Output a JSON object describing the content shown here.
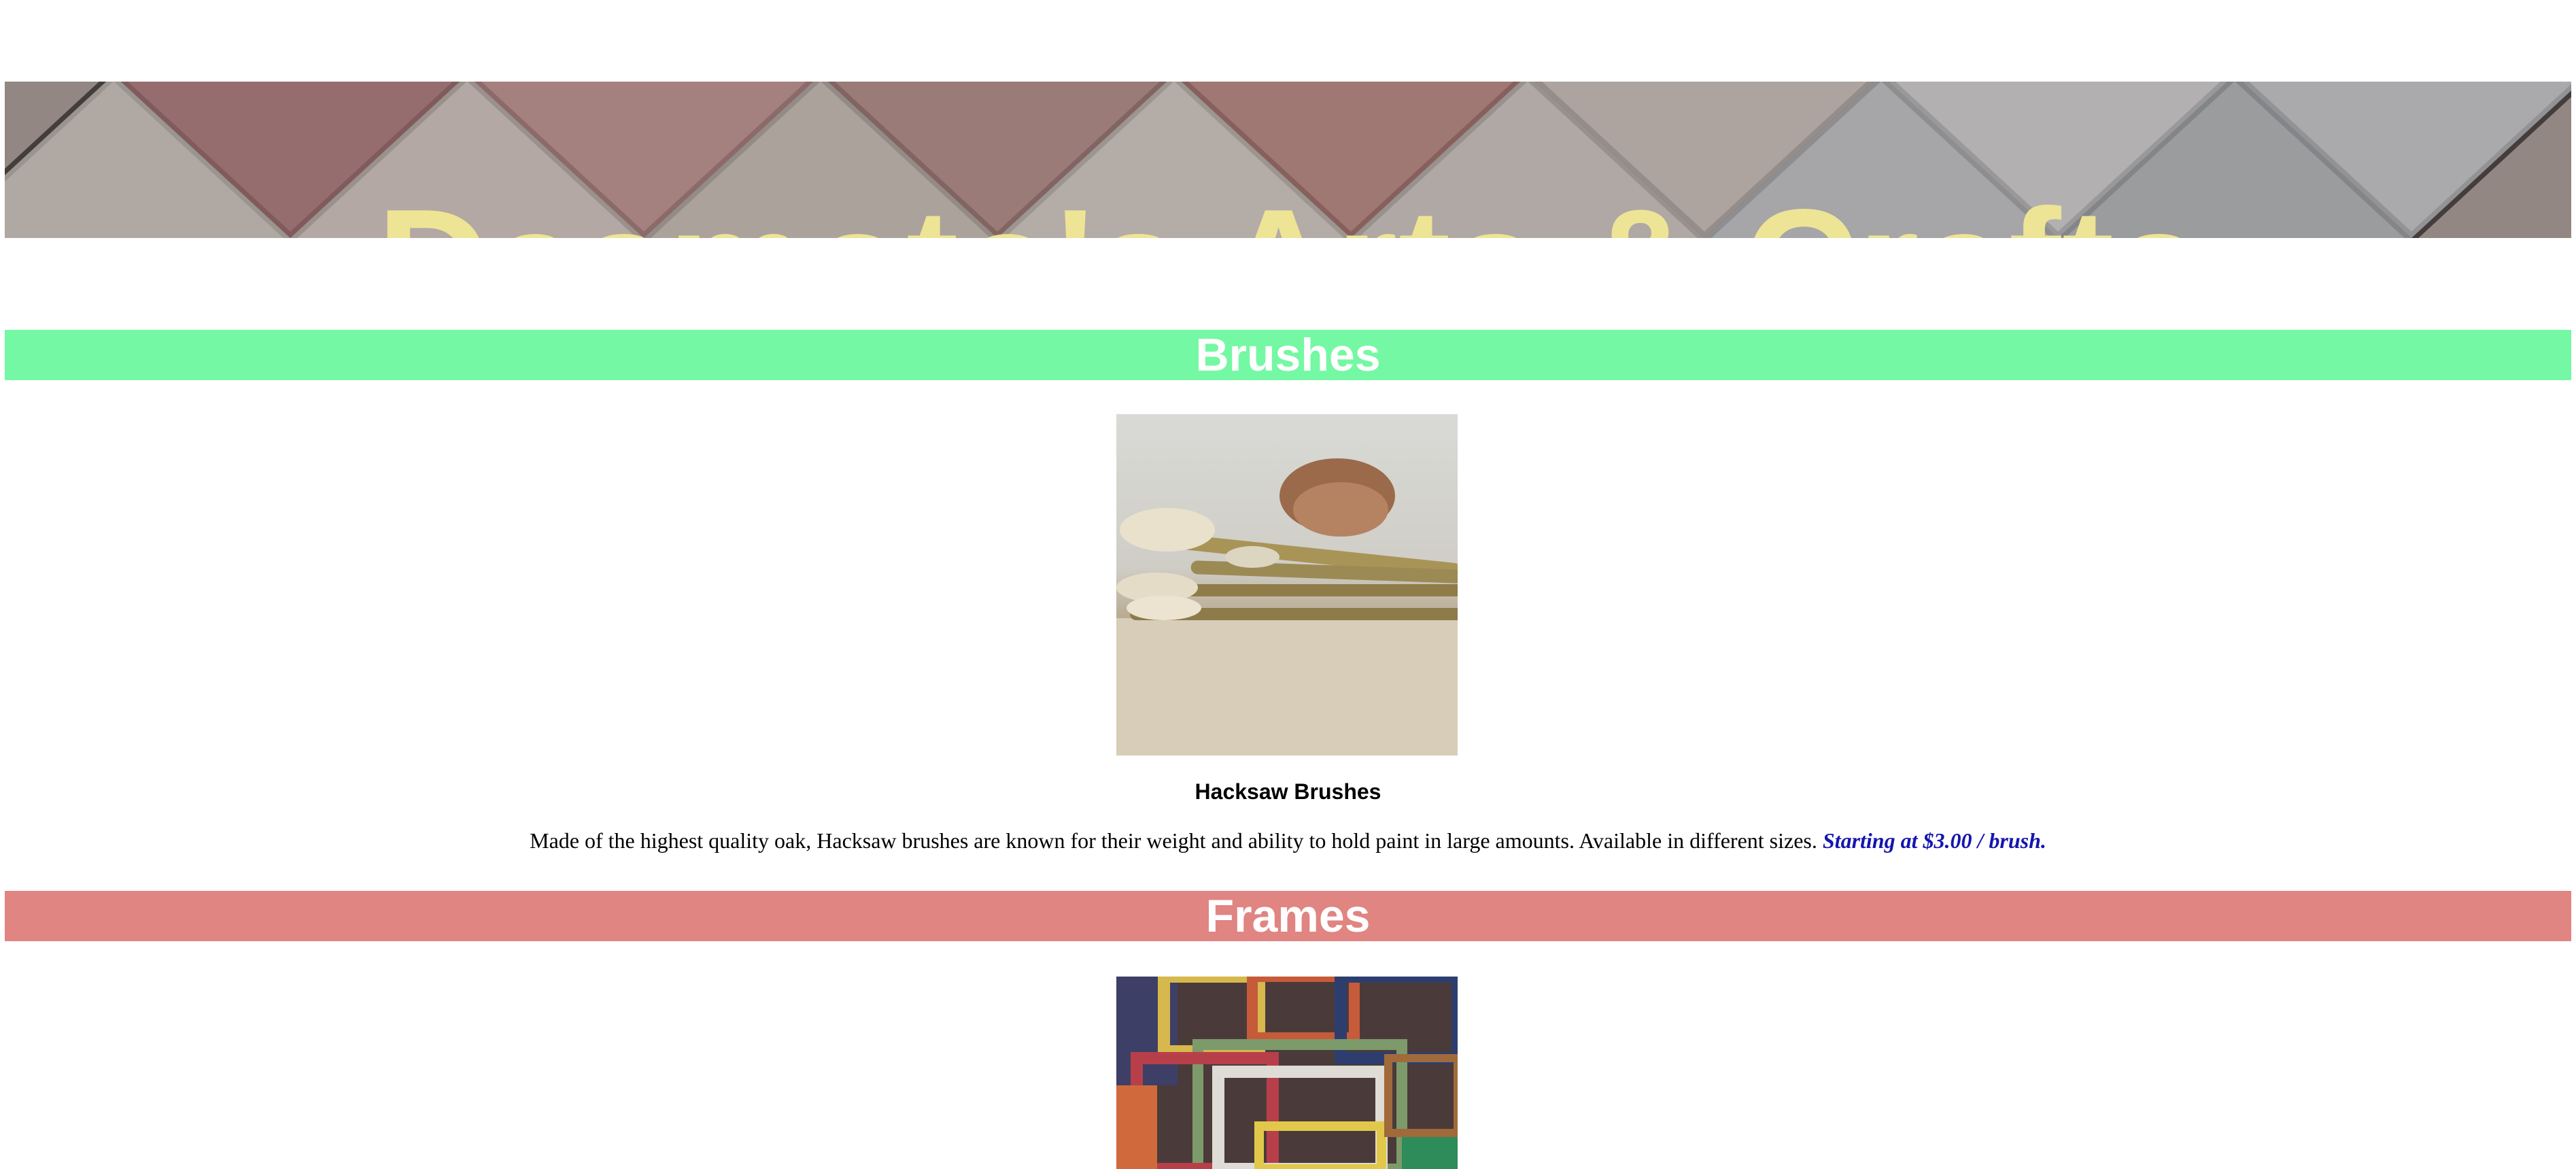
{
  "banner": {
    "title": "Dasmoto's Arts & Crafts"
  },
  "sections": [
    {
      "header": "Brushes",
      "color": "#75f8a3",
      "product": {
        "name": "Hacksaw Brushes",
        "description": "Made of the highest quality oak, Hacksaw brushes are known for their weight and ability to hold paint in large amounts. Available in different sizes.",
        "price": "Starting at $3.00 / brush."
      }
    },
    {
      "header": "Frames",
      "color": "#e08582"
    }
  ],
  "colors": {
    "banner_text": "#ede495",
    "price_text": "#1515b0"
  }
}
